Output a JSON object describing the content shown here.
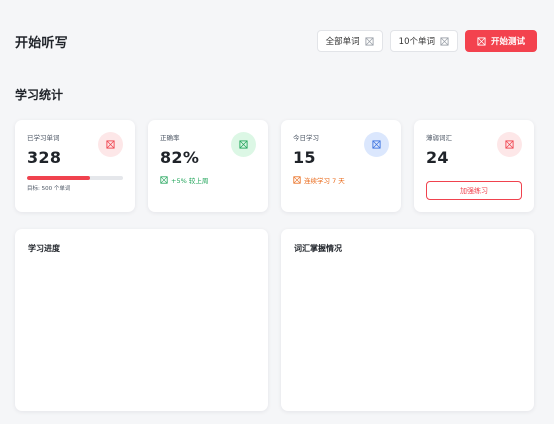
{
  "header": {
    "title": "开始听写",
    "filter_label": "全部单词",
    "count_label": "10个单词",
    "start_label": "开始测试"
  },
  "stats_section": {
    "title": "学习统计",
    "cards": [
      {
        "label": "已学习单词",
        "value": "328",
        "progress": 0.656,
        "caption": "目标: 500 个单词",
        "accent": "#f0424e",
        "icon_bg": "#fde7e8",
        "icon": "book-icon"
      },
      {
        "label": "正确率",
        "value": "82%",
        "trend": "+5% 较上周",
        "accent": "#22a55b",
        "icon_bg": "#dcf7e5",
        "icon": "check-icon"
      },
      {
        "label": "今日学习",
        "value": "15",
        "trend": "连续学习 7 天",
        "accent": "#ea6a1a",
        "icon_bg": "#dbe7fd",
        "icon_color": "#3b72e0",
        "icon": "calendar-icon"
      },
      {
        "label": "薄弱词汇",
        "value": "24",
        "button_label": "加强练习",
        "accent": "#f0424e",
        "icon_bg": "#fde7e8",
        "icon": "warning-icon"
      }
    ]
  },
  "panels": {
    "progress_title": "学习进度",
    "mastery_title": "词汇掌握情况"
  },
  "colors": {
    "primary": "#f3424e",
    "background": "#f5f6f8"
  }
}
